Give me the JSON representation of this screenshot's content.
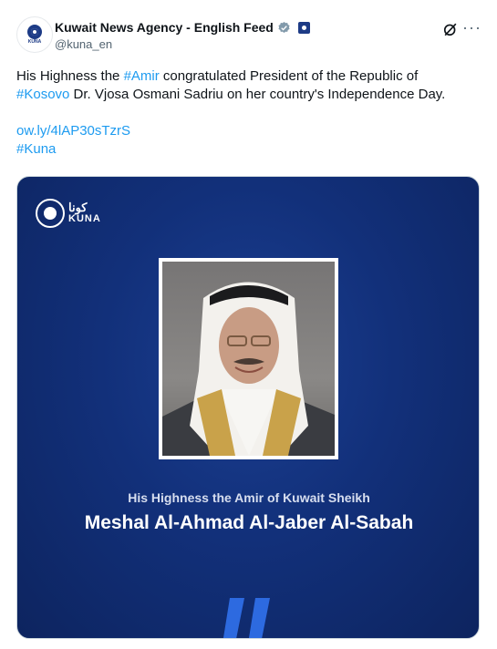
{
  "author": {
    "name": "Kuwait News Agency - English Feed",
    "handle": "@kuna_en",
    "avatar_text": "KUNA"
  },
  "tweet": {
    "line1_before": "His Highness the ",
    "line1_tag": "#Amir",
    "line1_after": " congratulated President of the Republic of",
    "line2_tag": "#Kosovo",
    "line2_after": " Dr. Vjosa Osmani Sadriu on her country's Independence Day.",
    "link": "ow.ly/4lAP30sTzrS",
    "hashtag": "#Kuna"
  },
  "media": {
    "logo_ar": "كونا",
    "logo_en": "KUNA",
    "caption_line1": "His Highness the Amir of Kuwait Sheikh",
    "caption_line2": "Meshal Al-Ahmad Al-Jaber Al-Sabah"
  },
  "icons": {
    "verified": "verified-badge-icon",
    "affiliate": "affiliate-badge-icon",
    "grok": "grok-icon",
    "more": "more-icon"
  },
  "colors": {
    "link": "#1d9bf0",
    "media_bg": "#12307a",
    "accent_quote": "#2d6ae0"
  }
}
